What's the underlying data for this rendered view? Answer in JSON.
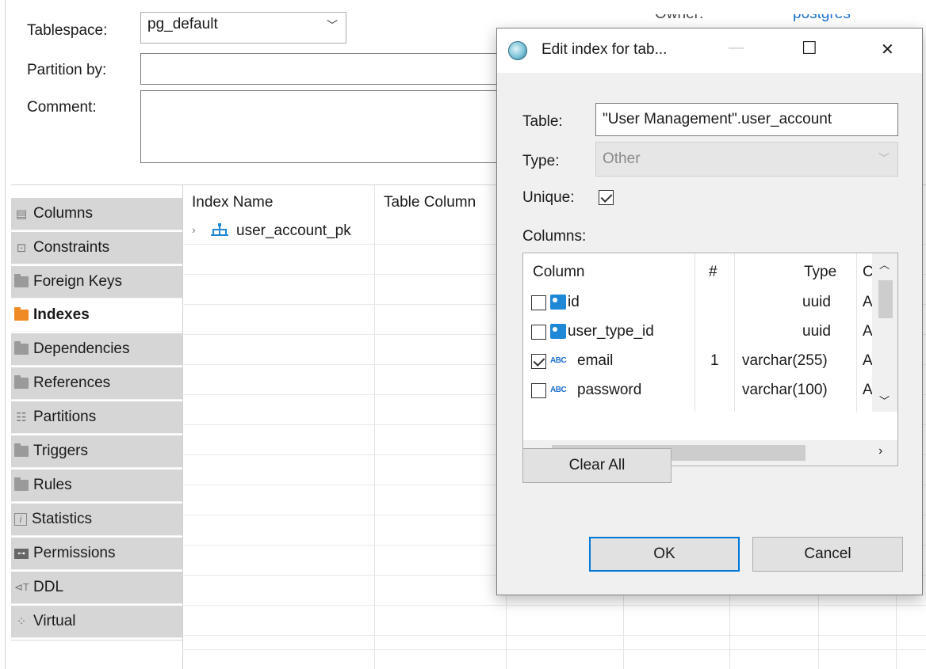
{
  "form": {
    "tablespace_label": "Tablespace:",
    "tablespace_value": "pg_default",
    "partition_label": "Partition by:",
    "partition_value": "",
    "comment_label": "Comment:",
    "comment_value": "",
    "owner_label": "Owner:",
    "owner_value": "postgres"
  },
  "tabs": [
    {
      "label": "Columns",
      "icon": "columns-icon",
      "active": false
    },
    {
      "label": "Constraints",
      "icon": "constraints-icon",
      "active": false
    },
    {
      "label": "Foreign Keys",
      "icon": "folder-icon",
      "active": false
    },
    {
      "label": "Indexes",
      "icon": "folder-icon",
      "active": true
    },
    {
      "label": "Dependencies",
      "icon": "folder-icon",
      "active": false
    },
    {
      "label": "References",
      "icon": "folder-icon",
      "active": false
    },
    {
      "label": "Partitions",
      "icon": "partitions-icon",
      "active": false
    },
    {
      "label": "Triggers",
      "icon": "folder-icon",
      "active": false
    },
    {
      "label": "Rules",
      "icon": "folder-icon",
      "active": false
    },
    {
      "label": "Statistics",
      "icon": "info-icon",
      "active": false
    },
    {
      "label": "Permissions",
      "icon": "key-icon",
      "active": false
    },
    {
      "label": "DDL",
      "icon": "ddl-icon",
      "active": false
    },
    {
      "label": "Virtual",
      "icon": "virtual-icon",
      "active": false
    }
  ],
  "index_grid": {
    "headers": [
      "Index Name",
      "Table Column"
    ],
    "rows": [
      {
        "name": "user_account_pk"
      }
    ]
  },
  "dialog": {
    "title": "Edit index for tab...",
    "table_label": "Table:",
    "table_value": "\"User Management\".user_account",
    "type_label": "Type:",
    "type_value": "Other",
    "unique_label": "Unique:",
    "unique_checked": true,
    "columns_label": "Columns:",
    "columns_headers": {
      "column": "Column",
      "order": "#",
      "type": "Type",
      "extra": "C"
    },
    "columns_rows": [
      {
        "name": "id",
        "order": "",
        "type": "uuid",
        "extra": "A",
        "checked": false,
        "icon": "primary-key-icon"
      },
      {
        "name": "user_type_id",
        "order": "",
        "type": "uuid",
        "extra": "A",
        "checked": false,
        "icon": "reference-column-icon"
      },
      {
        "name": "email",
        "order": "1",
        "type": "varchar(255)",
        "extra": "A",
        "checked": true,
        "icon": "text-column-icon"
      },
      {
        "name": "password",
        "order": "",
        "type": "varchar(100)",
        "extra": "A",
        "checked": false,
        "icon": "text-column-icon"
      }
    ],
    "abc_glyph": "ABC",
    "clear_all_label": "Clear All",
    "ok_label": "OK",
    "cancel_label": "Cancel",
    "minimize_glyph": "—",
    "maximize_glyph": "☐",
    "close_glyph": "✕"
  },
  "colors": {
    "accent": "#0078d7",
    "active_tab_icon": "#f08a24",
    "key_icon_blue": "#1e88d6",
    "owner_link": "#1a6fd1"
  }
}
